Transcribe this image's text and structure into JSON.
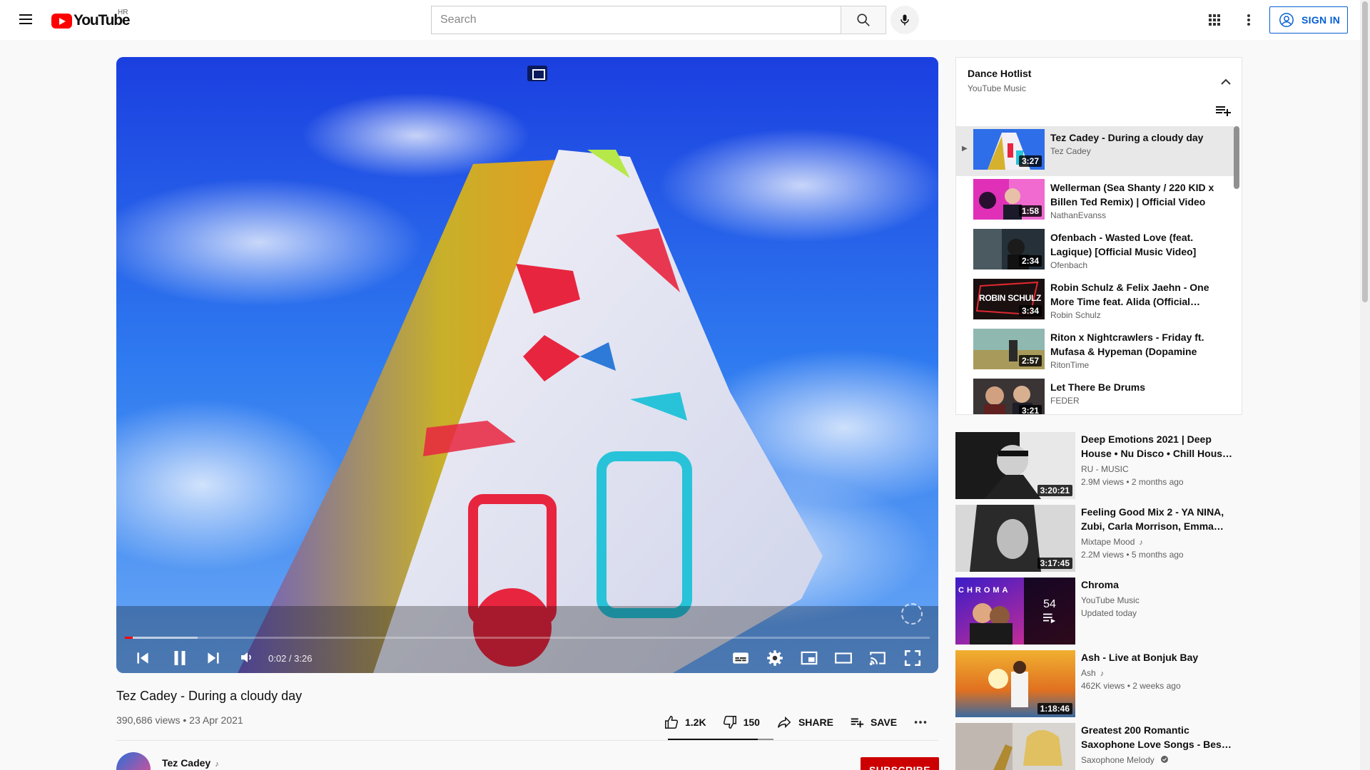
{
  "header": {
    "logo_text": "YouTube",
    "country": "HR",
    "search_placeholder": "Search",
    "signin_label": "SIGN IN"
  },
  "player": {
    "time_current": "0:02",
    "time_total": "3:26",
    "time_display": "0:02 / 3:26",
    "progress_fraction": 0.0097,
    "buffer_fraction": 0.09
  },
  "video": {
    "title": "Tez Cadey - During a cloudy day",
    "meta": "390,686 views • 23 Apr 2021",
    "likes": "1.2K",
    "dislikes": "150",
    "share_label": "SHARE",
    "save_label": "SAVE",
    "like_ratio": 0.85,
    "channel": "Tez Cadey",
    "subscribe_label": "SUBSCRIBE"
  },
  "playlist": {
    "title": "Dance Hotlist",
    "subtitle": "YouTube Music",
    "current_marker": "▶",
    "items": [
      {
        "title": "Tez Cadey - During a cloudy day",
        "channel": "Tez Cadey",
        "duration": "3:27"
      },
      {
        "title": "Wellerman (Sea Shanty / 220 KID x Billen Ted Remix) | Official Video",
        "channel": "NathanEvanss",
        "duration": "1:58"
      },
      {
        "title": "Ofenbach - Wasted Love (feat. Lagique) [Official Music Video]",
        "channel": "Ofenbach",
        "duration": "2:34"
      },
      {
        "title": "Robin Schulz & Felix Jaehn - One More Time feat. Alida (Official…",
        "channel": "Robin Schulz",
        "duration": "3:34",
        "thumb_text": "ROBIN SCHULZ"
      },
      {
        "title": "Riton x Nightcrawlers - Friday ft. Mufasa & Hypeman (Dopamine Re…",
        "channel": "RitonTime",
        "duration": "2:57"
      },
      {
        "title": "Let There Be Drums",
        "channel": "FEDER",
        "duration": "3:21"
      }
    ]
  },
  "recommendations": [
    {
      "title": "Deep Emotions 2021 | Deep House • Nu Disco • Chill Hous…",
      "channel": "RU - MUSIC",
      "meta": "2.9M views • 2 months ago",
      "duration": "3:20:21"
    },
    {
      "title": "Feeling Good Mix 2 - YA NINA, Zubi, Carla Morrison, Emma…",
      "channel": "Mixtape Mood",
      "meta": "2.2M views • 5 months ago",
      "duration": "3:17:45"
    },
    {
      "title": "Chroma",
      "channel": "YouTube Music",
      "meta": "Updated today",
      "count": "54",
      "thumb_text": "CHROMA"
    },
    {
      "title": "Ash - Live at Bonjuk Bay",
      "channel": "Ash",
      "meta": "462K views • 2 weeks ago",
      "duration": "1:18:46"
    },
    {
      "title": "Greatest 200 Romantic Saxophone Love Songs - Bes…",
      "channel": "Saxophone Melody",
      "meta": "",
      "duration": ""
    }
  ],
  "colors": {
    "brand_red": "#ff0000",
    "signin_blue": "#065fd4",
    "subscribe_red": "#cc0000"
  },
  "icons": [
    "menu-icon",
    "search-icon",
    "mic-icon",
    "apps-icon",
    "more-vert-icon",
    "account-icon",
    "prev-icon",
    "pause-icon",
    "next-icon",
    "volume-icon",
    "subtitles-icon",
    "settings-icon",
    "miniplayer-icon",
    "theater-icon",
    "cast-icon",
    "fullscreen-icon",
    "like-icon",
    "dislike-icon",
    "share-icon",
    "playlist-add-icon",
    "chevron-up-icon",
    "verified-icon",
    "music-note-icon"
  ]
}
